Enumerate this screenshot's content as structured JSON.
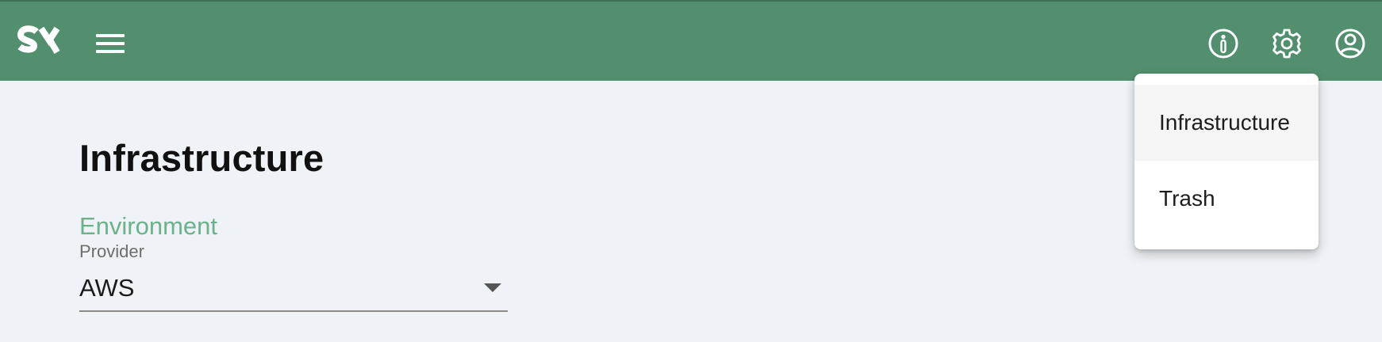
{
  "header": {
    "logo_text": "SY",
    "icons": [
      "menu-icon",
      "info-icon",
      "gear-icon",
      "account-icon"
    ],
    "background_color": "#528f6f"
  },
  "main": {
    "title": "Infrastructure",
    "section_label": "Environment",
    "provider": {
      "label": "Provider",
      "value": "AWS"
    },
    "accent_color": "#6bb28a"
  },
  "settings_menu": {
    "items": [
      {
        "label": "Infrastructure",
        "highlighted": true
      },
      {
        "label": "Trash",
        "highlighted": false
      }
    ]
  }
}
